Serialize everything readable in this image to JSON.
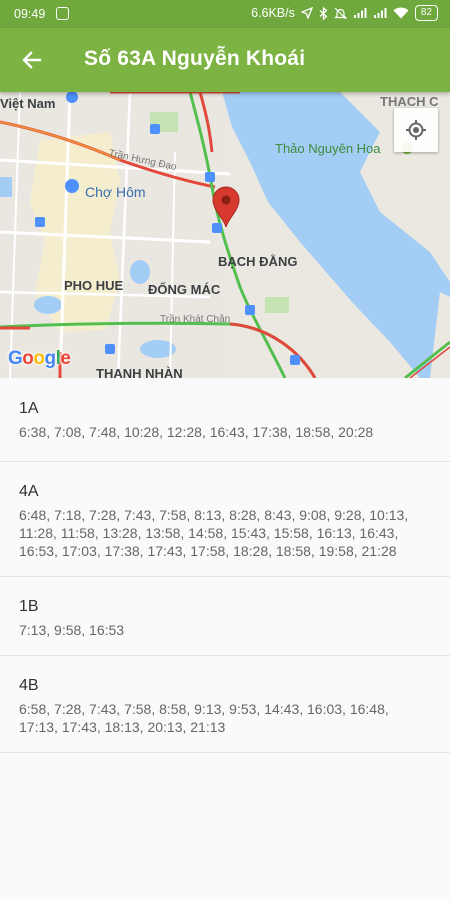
{
  "status_bar": {
    "time": "09:49",
    "network_speed": "6.6KB/s",
    "battery": "82"
  },
  "app_bar": {
    "title": "Số 63A Nguyễn Khoái",
    "back_icon": "arrow-back-icon"
  },
  "map": {
    "labels": {
      "viet_nam": "Việt Nam",
      "thach_c": "THACH C",
      "thao_nguyen_hoa": "Thảo Nguyên Hoa",
      "tran_hung_dao": "Trần Hưng Đạo",
      "cho_hom": "Chợ Hôm",
      "bach_dang": "BẠCH ĐẰNG",
      "pho_hue": "PHO HUE",
      "dong_mac": "ĐỐNG MÁC",
      "tran_khat_chan": "Trần Khát Chân",
      "thanh_nhan": "THANH NHÀN",
      "google": "Google"
    },
    "colors": {
      "water": "#a4cdf5",
      "park": "#c7e5b5",
      "district": "#fcf4c8",
      "road_congested": "#e2483b",
      "road_free": "#52bf4e",
      "pin": "#d7392e"
    }
  },
  "schedule": [
    {
      "route": "1A",
      "times": "6:38, 7:08, 7:48, 10:28, 12:28, 16:43, 17:38, 18:58, 20:28"
    },
    {
      "route": "4A",
      "times": "6:48, 7:18, 7:28, 7:43, 7:58, 8:13, 8:28, 8:43, 9:08, 9:28, 10:13, 11:28, 11:58, 13:28, 13:58, 14:58, 15:43, 15:58, 16:13, 16:43, 16:53, 17:03, 17:38, 17:43, 17:58, 18:28, 18:58, 19:58, 21:28"
    },
    {
      "route": "1B",
      "times": "7:13, 9:58, 16:53"
    },
    {
      "route": "4B",
      "times": "6:58, 7:28, 7:43, 7:58, 8:58, 9:13, 9:53, 14:43, 16:03, 16:48, 17:13, 17:43, 18:13, 20:13, 21:13"
    }
  ]
}
